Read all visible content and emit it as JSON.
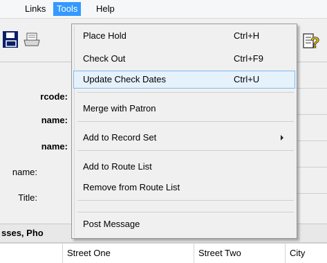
{
  "menubar": {
    "items": [
      {
        "label": "Links"
      },
      {
        "label": "Tools"
      },
      {
        "label": "Help"
      }
    ]
  },
  "toolbar": {
    "icons": [
      "save-icon",
      "print-icon",
      "help-icon"
    ]
  },
  "form": {
    "labels": [
      "rcode:",
      "name:",
      "name:",
      "name:",
      "Title:"
    ]
  },
  "section": {
    "title": "sses, Pho"
  },
  "grid": {
    "columns": [
      "Street One",
      "Street Two",
      "City"
    ]
  },
  "tools_menu": {
    "items": [
      {
        "label": "Place Hold",
        "shortcut": "Ctrl+H"
      },
      {
        "label": "Check Out",
        "shortcut": "Ctrl+F9"
      },
      {
        "label": "Update Check Dates",
        "shortcut": "Ctrl+U"
      },
      {
        "label": "Merge with Patron",
        "shortcut": ""
      },
      {
        "label": "Add to Record Set",
        "shortcut": ""
      },
      {
        "label": "Add to Route List",
        "shortcut": ""
      },
      {
        "label": "Remove from Route List",
        "shortcut": ""
      },
      {
        "label": "",
        "shortcut": ""
      },
      {
        "label": "Post Message",
        "shortcut": ""
      }
    ]
  },
  "colors": {
    "menu_active": "#3399ff",
    "menu_hover_bg": "#e5f1fb",
    "menu_hover_border": "#7fbaf0"
  }
}
